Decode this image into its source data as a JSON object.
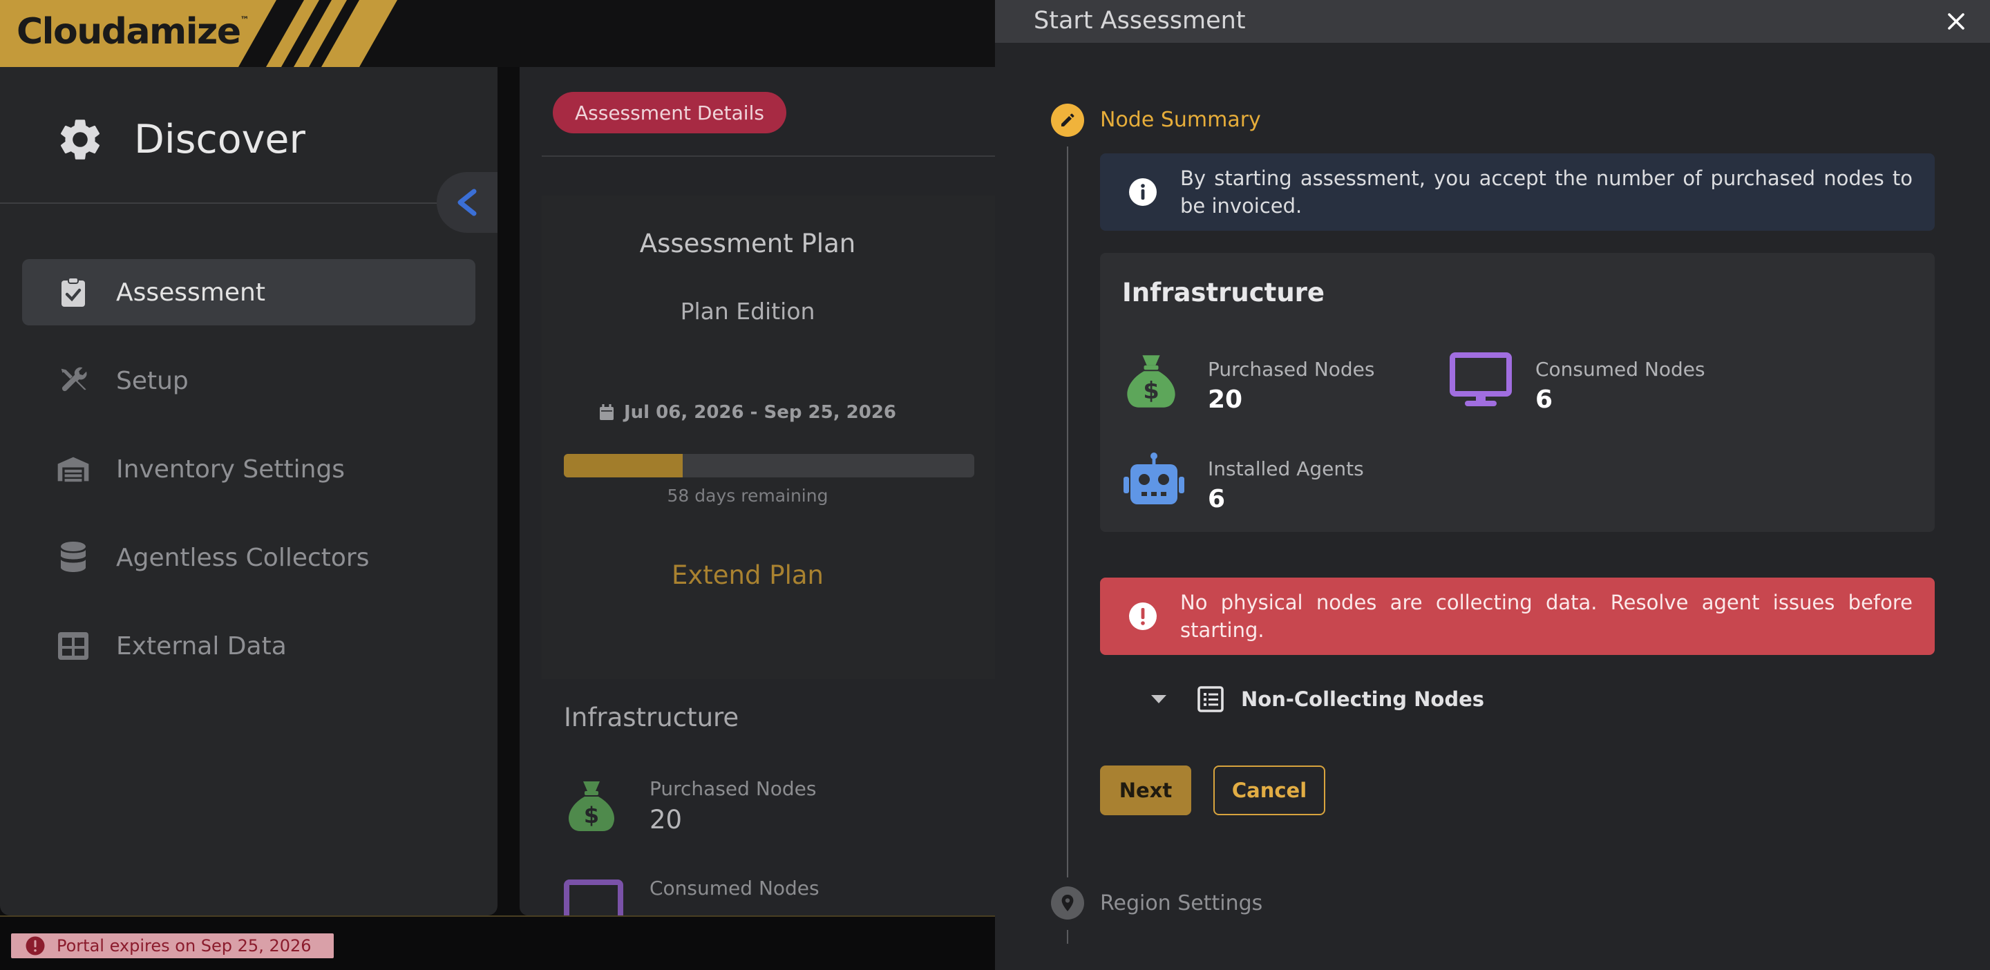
{
  "logo": {
    "text": "Cloudamize",
    "tm": "™"
  },
  "sidebar": {
    "title": "Discover",
    "items": [
      {
        "label": "Assessment",
        "icon": "clipboard-check-icon",
        "active": true
      },
      {
        "label": "Setup",
        "icon": "tools-icon"
      },
      {
        "label": "Inventory Settings",
        "icon": "warehouse-icon"
      },
      {
        "label": "Agentless Collectors",
        "icon": "database-icon"
      },
      {
        "label": "External Data",
        "icon": "table-icon"
      }
    ]
  },
  "middle": {
    "pill": "Assessment Details",
    "plan_title": "Assessment Plan",
    "plan_edition": "Plan Edition",
    "dates": "Jul 06, 2026 - Sep 25, 2026",
    "progress_fraction": 0.29,
    "remaining": "58 days remaining",
    "extend": "Extend Plan",
    "infra_title": "Infrastructure",
    "purchased_label": "Purchased Nodes",
    "purchased_value": "20",
    "consumed_label": "Consumed Nodes"
  },
  "status": {
    "expires": "Portal expires on Sep 25, 2026"
  },
  "modal": {
    "title": "Start Assessment",
    "step1": "Node Summary",
    "info": "By starting assessment, you accept the number of purchased nodes to be invoiced.",
    "infra": {
      "title": "Infrastructure",
      "purchased_label": "Purchased Nodes",
      "purchased_value": "20",
      "consumed_label": "Consumed Nodes",
      "consumed_value": "6",
      "agents_label": "Installed Agents",
      "agents_value": "6"
    },
    "error": "No physical nodes are collecting data. Resolve agent issues before starting.",
    "noncollecting": "Non-Collecting Nodes",
    "next": "Next",
    "cancel": "Cancel",
    "step2": "Region Settings"
  },
  "colors": {
    "accent": "#f0b33b",
    "danger": "#c8474f",
    "info_bg": "#283040",
    "pill": "#a72a43",
    "money_green": "#5da65a",
    "monitor_purple": "#a16ee0",
    "robot_blue": "#5f96e6"
  }
}
